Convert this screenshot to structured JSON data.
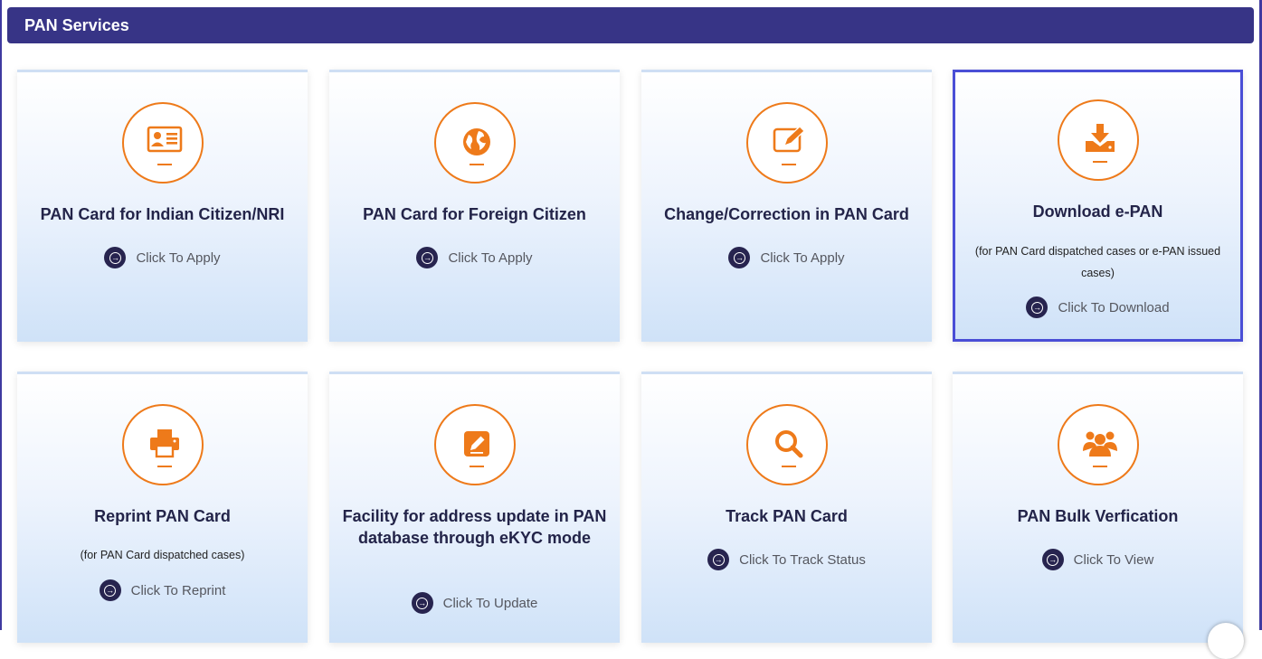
{
  "header": {
    "title": "PAN Services"
  },
  "colors": {
    "header_bg": "#373486",
    "accent_orange": "#ee7a1a",
    "arrow_bg": "#27244f",
    "selected_border": "#4a4ed6"
  },
  "cards": [
    {
      "icon": "id-card-icon",
      "title": "PAN Card for Indian Citizen/NRI",
      "note": "",
      "action": "Click To Apply"
    },
    {
      "icon": "globe-icon",
      "title": "PAN Card for Foreign Citizen",
      "note": "",
      "action": "Click To Apply"
    },
    {
      "icon": "edit-screen-icon",
      "title": "Change/Correction in PAN Card",
      "note": "",
      "action": "Click To Apply"
    },
    {
      "icon": "download-icon",
      "title": "Download e-PAN",
      "note": "(for PAN Card dispatched cases or e-PAN issued cases)",
      "action": "Click To Download",
      "selected": true
    },
    {
      "icon": "printer-icon",
      "title": "Reprint PAN Card",
      "note": "(for PAN Card dispatched cases)",
      "action": "Click To Reprint"
    },
    {
      "icon": "pencil-square-icon",
      "title": "Facility for address update in PAN database through eKYC mode",
      "note": "",
      "action": "Click To Update"
    },
    {
      "icon": "magnifier-icon",
      "title": "Track PAN Card",
      "note": "",
      "action": "Click To Track Status"
    },
    {
      "icon": "group-users-icon",
      "title": "PAN Bulk Verfication",
      "note": "",
      "action": "Click To View"
    }
  ]
}
